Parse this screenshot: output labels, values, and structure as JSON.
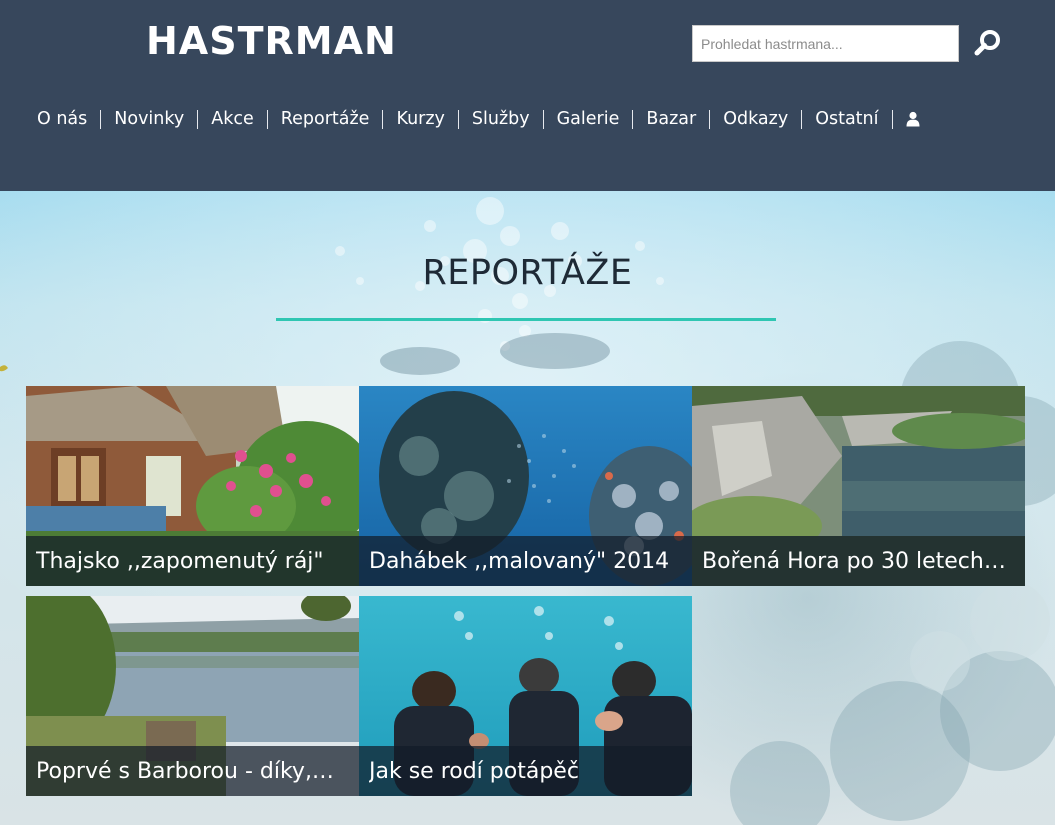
{
  "site": {
    "logo": "HASTRMAN"
  },
  "search": {
    "placeholder": "Prohledat hastrmana...",
    "value": ""
  },
  "nav": {
    "items": [
      {
        "label": "O nás"
      },
      {
        "label": "Novinky"
      },
      {
        "label": "Akce"
      },
      {
        "label": "Reportáže"
      },
      {
        "label": "Kurzy"
      },
      {
        "label": "Služby"
      },
      {
        "label": "Galerie"
      },
      {
        "label": "Bazar"
      },
      {
        "label": "Odkazy"
      },
      {
        "label": "Ostatní"
      }
    ],
    "user_icon": "user-icon"
  },
  "page": {
    "title": "REPORTÁŽE"
  },
  "cards": [
    {
      "title": "Thajsko ,,zapomenutý ráj\"",
      "image": "thailand-bungalow-with-flowers"
    },
    {
      "title": "Dahábek ,,malovaný\" 2014",
      "image": "coral-reef-with-fish-school"
    },
    {
      "title": "Bořená Hora po 30 letech…",
      "image": "quarry-lake-with-rocks"
    },
    {
      "title": "Poprvé s Barborou - díky,…",
      "image": "lake-shore-landscape"
    },
    {
      "title": "Jak se rodí potápěč",
      "image": "divers-in-pool"
    }
  ],
  "colors": {
    "header_bg": "#37475c",
    "accent": "#2fc6b2",
    "caption_bg": "rgba(18,28,40,0.72)"
  }
}
